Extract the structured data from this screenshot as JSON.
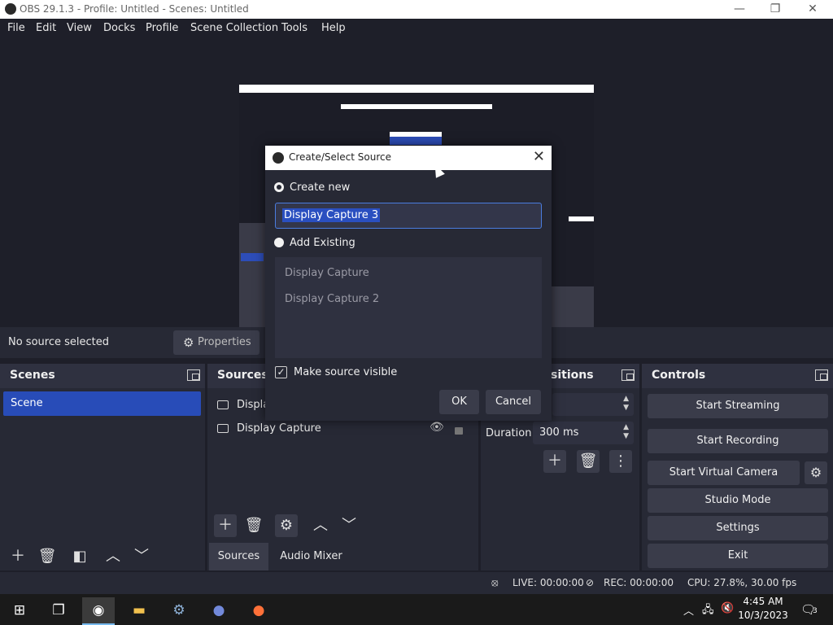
{
  "window": {
    "title": "OBS 29.1.3 - Profile: Untitled - Scenes: Untitled",
    "minimize_glyph": "—",
    "maximize_glyph": "❐",
    "close_glyph": "✕"
  },
  "menu": [
    "File",
    "Edit",
    "View",
    "Docks",
    "Profile",
    "Scene Collection",
    "Tools",
    "Help"
  ],
  "context_bar": {
    "no_source": "No source selected",
    "properties_label": "Properties"
  },
  "scenes_dock": {
    "title": "Scenes",
    "items": [
      "Scene"
    ]
  },
  "sources_dock": {
    "title": "Sources",
    "items": [
      "Displa",
      "Display Capture"
    ],
    "tabs": [
      "Sources",
      "Audio Mixer"
    ]
  },
  "transitions_dock": {
    "title": "Transitions",
    "title_visible": "sitions",
    "duration_label": "Duration",
    "duration_value": "300 ms"
  },
  "controls_dock": {
    "title": "Controls",
    "buttons": [
      "Start Streaming",
      "Start Recording",
      "Start Virtual Camera",
      "Studio Mode",
      "Settings",
      "Exit"
    ]
  },
  "status": {
    "live": "LIVE: 00:00:00",
    "rec": "REC: 00:00:00",
    "cpu": "CPU: 27.8%, 30.00 fps"
  },
  "taskbar": {
    "time": "4:45 AM",
    "date": "10/3/2023",
    "notification_count": "3",
    "apps": [
      "start-icon",
      "task-view-icon",
      "obs-icon",
      "file-explorer-icon",
      "steam-icon",
      "discord-icon",
      "firefox-icon"
    ]
  },
  "dialog": {
    "title": "Create/Select Source",
    "close_glyph": "✕",
    "create_new_label": "Create new",
    "name_value": "Display Capture 3",
    "add_existing_label": "Add Existing",
    "existing_items": [
      "Display Capture",
      "Display Capture 2"
    ],
    "make_visible_label": "Make source visible",
    "ok_label": "OK",
    "cancel_label": "Cancel"
  },
  "colors": {
    "background": "#1e1f29",
    "panel": "#272935",
    "accent": "#284cb8",
    "button": "#3a3c4a"
  }
}
